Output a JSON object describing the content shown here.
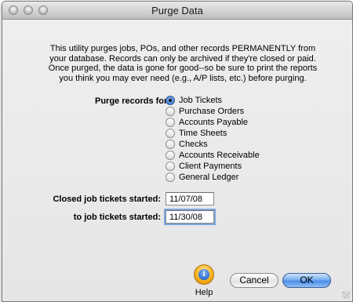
{
  "window": {
    "title": "Purge Data"
  },
  "description": "This utility purges jobs, POs, and other records PERMANENTLY from your database.  Records can only be archived if they're closed or paid.  Once purged, the data is gone for good--so be sure to print the reports you think you may ever need (e.g., A/P lists, etc.) before purging.",
  "purge": {
    "label": "Purge records for:",
    "options": [
      {
        "label": "Job Tickets",
        "selected": true
      },
      {
        "label": "Purchase Orders",
        "selected": false
      },
      {
        "label": "Accounts Payable",
        "selected": false
      },
      {
        "label": "Time Sheets",
        "selected": false
      },
      {
        "label": "Checks",
        "selected": false
      },
      {
        "label": "Accounts Receivable",
        "selected": false
      },
      {
        "label": "Client Payments",
        "selected": false
      },
      {
        "label": "General Ledger",
        "selected": false
      }
    ]
  },
  "fields": {
    "closed_label": "Closed job tickets started:",
    "closed_value": "11/07/08",
    "to_label": "to job tickets started:",
    "to_value": "11/30/08"
  },
  "buttons": {
    "help": "Help",
    "help_icon": "info-icon",
    "cancel": "Cancel",
    "ok": "OK"
  },
  "colors": {
    "accent": "#4d8ee6",
    "help_badge": "#f5b21a"
  }
}
